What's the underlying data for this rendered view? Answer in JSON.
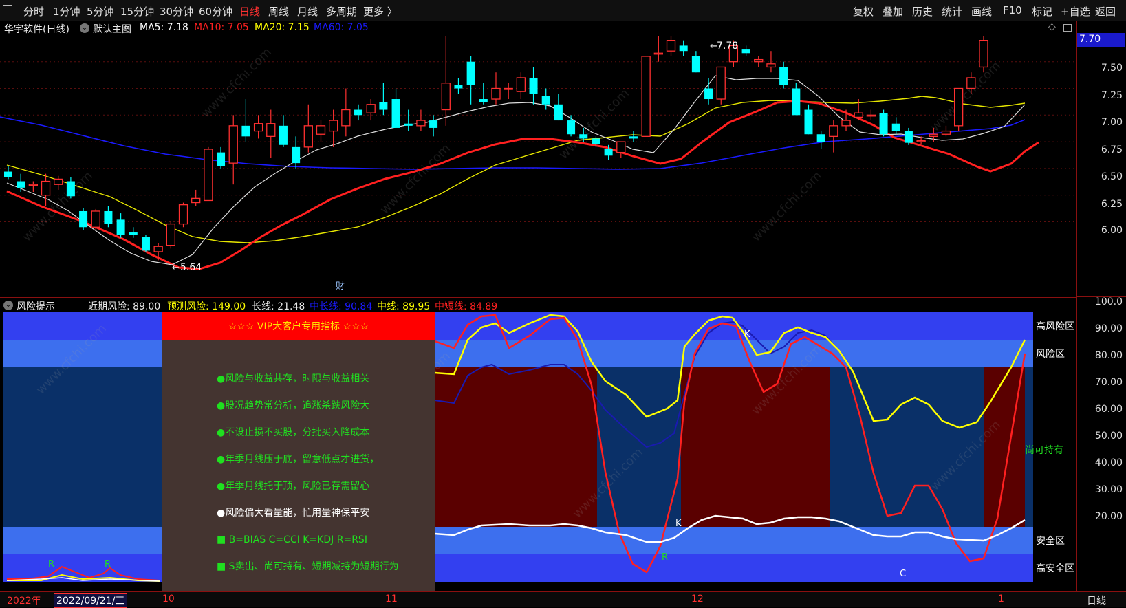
{
  "toolbar": {
    "icon": "panel-toggle-icon",
    "left_items": [
      "分时",
      "1分钟",
      "5分钟",
      "15分钟",
      "30分钟",
      "60分钟",
      "日线",
      "周线",
      "月线",
      "多周期",
      "更多 〉"
    ],
    "active": "日线",
    "right_items": [
      "复权",
      "叠加",
      "历史",
      "统计",
      "画线",
      "F10",
      "标记",
      "+自选",
      "返回"
    ]
  },
  "main_header": {
    "stock": "华宇软件(日线)",
    "template": "默认主图",
    "ma5": "MA5: 7.18",
    "ma10": "MA10: 7.05",
    "ma20": "MA20: 7.15",
    "ma60": "MA60: 7.05",
    "colors": {
      "ma5": "#ffffff",
      "ma10": "#ff2020",
      "ma20": "#ffff00",
      "ma60": "#1a1aff"
    }
  },
  "price_axis": {
    "current": "7.70",
    "ticks": [
      "7.50",
      "7.25",
      "7.00",
      "6.75",
      "6.50",
      "6.25",
      "6.00"
    ]
  },
  "annotations": {
    "high": "7.78",
    "low": "5.64",
    "finance_marker": "财"
  },
  "sub_header": {
    "name": "风险提示",
    "near": "近期风险: 89.00",
    "forecast": "预测风险: 149.00",
    "long": "长线: 21.48",
    "midlong": "中长线: 90.84",
    "mid": "中线: 89.95",
    "short": "中短线: 84.89"
  },
  "sub_axis": {
    "ticks": [
      "100.0",
      "90.00",
      "80.00",
      "70.00",
      "60.00",
      "50.00",
      "40.00",
      "30.00",
      "20.00"
    ]
  },
  "zones": {
    "high_risk": "高风险区",
    "risk": "风险区",
    "hold": "尚可持有",
    "safe": "安全区",
    "high_safe": "高安全区"
  },
  "vip_panel": {
    "title": "☆☆☆  VIP大客户专用指标  ☆☆☆",
    "lines": [
      "●风险与收益共存，时限与收益相关",
      "●股况趋势常分析，追涨杀跌风险大",
      "●不设止损不买股，分批买入降成本",
      "●年季月线压于底，留意低点才进货，",
      "●年季月线托于顶，风险已存需留心",
      "●风险偏大看量能，忙用量神保平安",
      "■ B=BIAS    C=CCI     K=KDJ     R=RSI",
      "■ S卖出、尚可持有、短期减持为短期行为"
    ]
  },
  "signal_letters": {
    "r1": "R",
    "r2": "R",
    "k1": "K",
    "k2": "K",
    "r3": "R",
    "c1": "C"
  },
  "bottom": {
    "year": "2022年",
    "date": "2022/09/21/三",
    "month_10": "10",
    "month_11": "11",
    "month_12": "12",
    "month_1": "1",
    "period": "日线"
  },
  "watermark": "www.cfchi.com",
  "chart_data": {
    "type": "candlestick",
    "price_range": [
      5.5,
      7.9
    ],
    "candles_ohlc": [
      [
        6.47,
        6.52,
        6.4,
        6.42
      ],
      [
        6.38,
        6.45,
        6.28,
        6.32
      ],
      [
        6.35,
        6.38,
        6.28,
        6.35
      ],
      [
        6.25,
        6.45,
        6.15,
        6.38
      ],
      [
        6.35,
        6.43,
        6.3,
        6.4
      ],
      [
        6.38,
        6.42,
        6.22,
        6.24
      ],
      [
        6.1,
        6.13,
        5.92,
        5.95
      ],
      [
        5.95,
        6.12,
        5.92,
        6.1
      ],
      [
        6.1,
        6.15,
        5.95,
        5.98
      ],
      [
        6.02,
        6.08,
        5.85,
        5.88
      ],
      [
        5.9,
        5.95,
        5.85,
        5.88
      ],
      [
        5.86,
        5.88,
        5.72,
        5.73
      ],
      [
        5.72,
        5.8,
        5.64,
        5.77
      ],
      [
        5.78,
        6.0,
        5.75,
        5.98
      ],
      [
        5.98,
        6.18,
        5.95,
        6.16
      ],
      [
        6.18,
        6.3,
        6.15,
        6.22
      ],
      [
        6.2,
        6.7,
        6.2,
        6.68
      ],
      [
        6.65,
        6.7,
        6.5,
        6.52
      ],
      [
        6.55,
        7.0,
        6.35,
        6.9
      ],
      [
        6.9,
        7.15,
        6.75,
        6.8
      ],
      [
        6.85,
        7.0,
        6.78,
        6.92
      ],
      [
        6.8,
        7.05,
        6.6,
        6.92
      ],
      [
        6.9,
        7.0,
        6.7,
        6.72
      ],
      [
        6.7,
        6.8,
        6.5,
        6.55
      ],
      [
        6.7,
        7.1,
        6.65,
        6.9
      ],
      [
        6.82,
        6.95,
        6.75,
        6.9
      ],
      [
        6.85,
        7.05,
        6.7,
        6.95
      ],
      [
        6.9,
        7.25,
        6.8,
        7.05
      ],
      [
        7.05,
        7.1,
        6.95,
        7.0
      ],
      [
        7.02,
        7.15,
        6.95,
        7.1
      ],
      [
        7.12,
        7.3,
        7.0,
        7.05
      ],
      [
        7.15,
        7.25,
        6.9,
        6.88
      ],
      [
        6.92,
        7.05,
        6.85,
        6.9
      ],
      [
        6.9,
        7.05,
        6.85,
        6.95
      ],
      [
        6.95,
        7.0,
        6.8,
        6.88
      ],
      [
        7.05,
        7.75,
        6.9,
        7.3
      ],
      [
        7.28,
        7.35,
        7.2,
        7.25
      ],
      [
        7.5,
        7.55,
        7.1,
        7.28
      ],
      [
        7.15,
        7.3,
        7.1,
        7.12
      ],
      [
        7.15,
        7.4,
        7.1,
        7.25
      ],
      [
        7.25,
        7.3,
        7.15,
        7.25
      ],
      [
        7.22,
        7.4,
        7.15,
        7.35
      ],
      [
        7.35,
        7.45,
        7.1,
        7.2
      ],
      [
        7.18,
        7.25,
        7.05,
        7.1
      ],
      [
        7.1,
        7.2,
        6.95,
        6.95
      ],
      [
        6.95,
        7.0,
        6.8,
        6.82
      ],
      [
        6.82,
        6.88,
        6.75,
        6.78
      ],
      [
        6.78,
        6.8,
        6.7,
        6.73
      ],
      [
        6.68,
        6.72,
        6.58,
        6.62
      ],
      [
        6.65,
        6.75,
        6.6,
        6.75
      ],
      [
        6.8,
        6.85,
        6.75,
        6.78
      ],
      [
        6.8,
        7.55,
        6.8,
        7.55
      ],
      [
        7.58,
        7.75,
        7.5,
        7.58
      ],
      [
        7.6,
        7.78,
        7.55,
        7.7
      ],
      [
        7.65,
        7.7,
        7.55,
        7.6
      ],
      [
        7.55,
        7.6,
        7.4,
        7.4
      ],
      [
        7.25,
        7.35,
        7.1,
        7.15
      ],
      [
        7.15,
        7.45,
        7.1,
        7.45
      ],
      [
        7.5,
        7.7,
        7.45,
        7.65
      ],
      [
        7.62,
        7.65,
        7.55,
        7.58
      ],
      [
        7.5,
        7.55,
        7.45,
        7.52
      ],
      [
        7.45,
        7.6,
        7.4,
        7.48
      ],
      [
        7.45,
        7.5,
        7.25,
        7.28
      ],
      [
        7.25,
        7.3,
        7.0,
        7.0
      ],
      [
        7.05,
        7.1,
        6.82,
        6.82
      ],
      [
        6.82,
        6.85,
        6.68,
        6.75
      ],
      [
        6.8,
        6.95,
        6.65,
        6.9
      ],
      [
        6.9,
        7.05,
        6.85,
        6.95
      ],
      [
        6.98,
        7.15,
        6.95,
        7.02
      ],
      [
        7.0,
        7.05,
        6.95,
        7.0
      ],
      [
        7.02,
        7.05,
        6.8,
        6.82
      ],
      [
        6.92,
        6.98,
        6.82,
        6.85
      ],
      [
        6.85,
        6.88,
        6.72,
        6.74
      ],
      [
        6.76,
        6.8,
        6.73,
        6.76
      ],
      [
        6.8,
        6.88,
        6.75,
        6.82
      ],
      [
        6.82,
        6.9,
        6.8,
        6.85
      ],
      [
        6.9,
        7.25,
        6.85,
        7.25
      ],
      [
        7.25,
        7.4,
        7.2,
        7.35
      ],
      [
        7.45,
        7.78,
        7.4,
        7.7
      ]
    ]
  }
}
